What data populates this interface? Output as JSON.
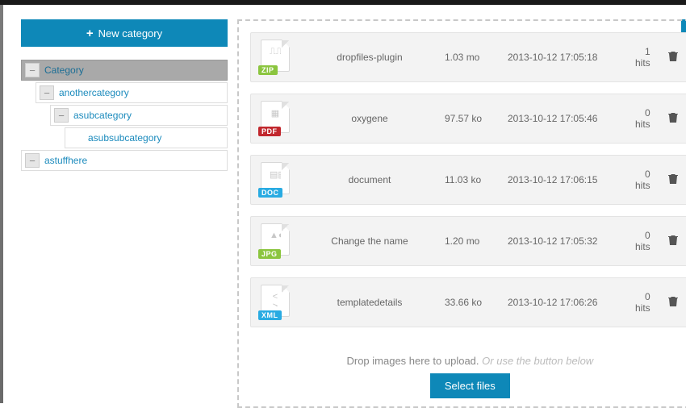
{
  "sidebar": {
    "new_category_label": "New category",
    "tree": [
      {
        "label": "Category",
        "depth": 0,
        "active": true,
        "hasToggle": true
      },
      {
        "label": "anothercategory",
        "depth": 1,
        "active": false,
        "hasToggle": true
      },
      {
        "label": "asubcategory",
        "depth": 2,
        "active": false,
        "hasToggle": true
      },
      {
        "label": "asubsubcategory",
        "depth": 3,
        "active": false,
        "hasToggle": false
      },
      {
        "label": "astuffhere",
        "depth": 0,
        "active": false,
        "hasToggle": true
      }
    ]
  },
  "files": [
    {
      "type": "ZIP",
      "badgeClass": "b-zip",
      "glyph": "⎍⎍⎍⎍▸",
      "name": "dropfiles-plugin",
      "size": "1.03 mo",
      "date": "2013-10-12 17:05:18",
      "hits": "1 hits"
    },
    {
      "type": "PDF",
      "badgeClass": "b-pdf",
      "glyph": "▦",
      "name": "oxygene",
      "size": "97.57 ko",
      "date": "2013-10-12 17:05:46",
      "hits": "0 hits"
    },
    {
      "type": "DOC",
      "badgeClass": "b-doc",
      "glyph": "▤▤",
      "name": "document",
      "size": "11.03 ko",
      "date": "2013-10-12 17:06:15",
      "hits": "0 hits"
    },
    {
      "type": "JPG",
      "badgeClass": "b-jpg",
      "glyph": "▲●",
      "name": "Change the name",
      "size": "1.20 mo",
      "date": "2013-10-12 17:05:32",
      "hits": "0 hits"
    },
    {
      "type": "XML",
      "badgeClass": "b-xml",
      "glyph": "< >",
      "name": "templatedetails",
      "size": "33.66 ko",
      "date": "2013-10-12 17:06:26",
      "hits": "0 hits"
    }
  ],
  "dropzone": {
    "text": "Drop images here to upload.",
    "hint": "Or use the button below",
    "button": "Select files"
  }
}
